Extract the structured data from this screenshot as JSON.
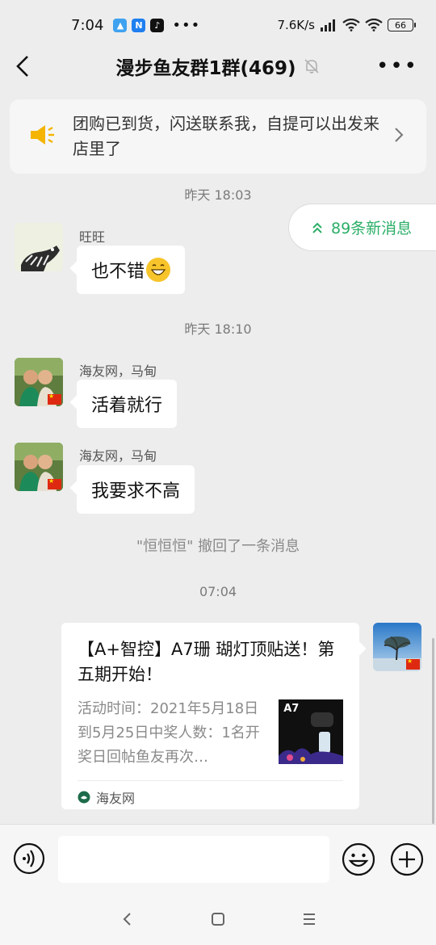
{
  "status_bar": {
    "time": "7:04",
    "dots": "•••",
    "speed": "7.6K/s",
    "battery": "66"
  },
  "header": {
    "title": "漫步鱼友群1群(469)"
  },
  "notice": {
    "text": "团购已到货，闪送联系我，自提可以出发来店里了"
  },
  "new_messages": {
    "label": "89条新消息"
  },
  "messages": [
    {
      "timestamp": "昨天 18:03",
      "sender": "旺旺",
      "text": "也不错"
    },
    {
      "timestamp": "昨天 18:10",
      "sender": "海友网，马甸",
      "text": "活着就行"
    },
    {
      "sender": "海友网，马甸",
      "text": "我要求不高"
    }
  ],
  "recall_notice": "\"恒恒恒\" 撤回了一条消息",
  "latest_time": "07:04",
  "card": {
    "title": "【A+智控】A7珊 瑚灯顶贴送！第五期开始！",
    "description": "活动时间：2021年5月18日到5月25日中奖人数：1名开奖日回帖鱼友再次…",
    "thumb_text": "A7",
    "source": "海友网"
  },
  "input": {
    "placeholder": ""
  },
  "colors": {
    "accent_green": "#2aae67",
    "notice_icon": "#f4b400"
  }
}
